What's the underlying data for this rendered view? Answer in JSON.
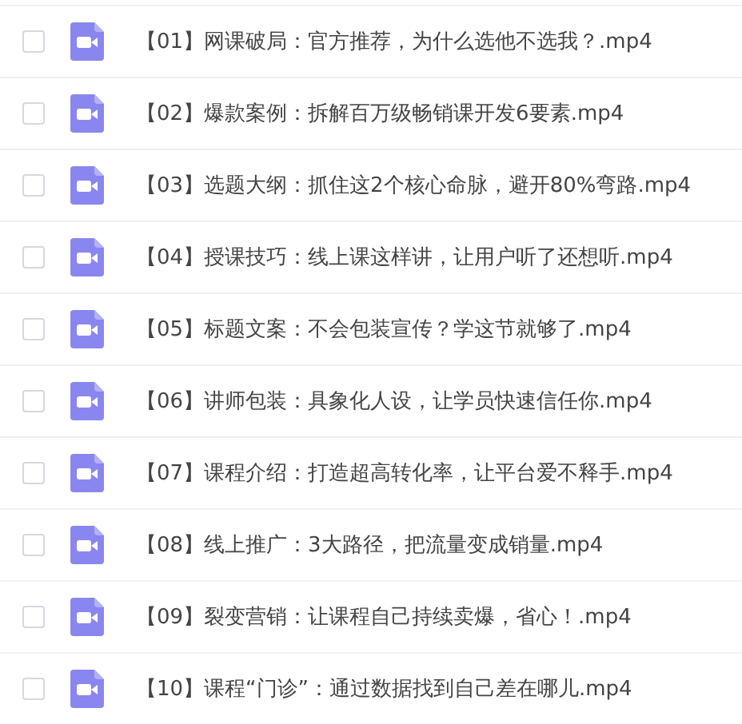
{
  "files": [
    {
      "name": "【01】网课破局：官方推荐，为什么选他不选我？.mp4",
      "checked": false
    },
    {
      "name": "【02】爆款案例：拆解百万级畅销课开发6要素.mp4",
      "checked": false
    },
    {
      "name": "【03】选题大纲：抓住这2个核心命脉，避开80%弯路.mp4",
      "checked": false
    },
    {
      "name": "【04】授课技巧：线上课这样讲，让用户听了还想听.mp4",
      "checked": false
    },
    {
      "name": "【05】标题文案：不会包装宣传？学这节就够了.mp4",
      "checked": false
    },
    {
      "name": "【06】讲师包装：具象化人设，让学员快速信任你.mp4",
      "checked": false
    },
    {
      "name": "【07】课程介绍：打造超高转化率，让平台爱不释手.mp4",
      "checked": false
    },
    {
      "name": "【08】线上推广：3大路径，把流量变成销量.mp4",
      "checked": false
    },
    {
      "name": "【09】裂变营销：让课程自己持续卖爆，省心！.mp4",
      "checked": false
    },
    {
      "name": "【10】课程“门诊”：通过数据找到自己差在哪儿.mp4",
      "checked": false
    }
  ]
}
